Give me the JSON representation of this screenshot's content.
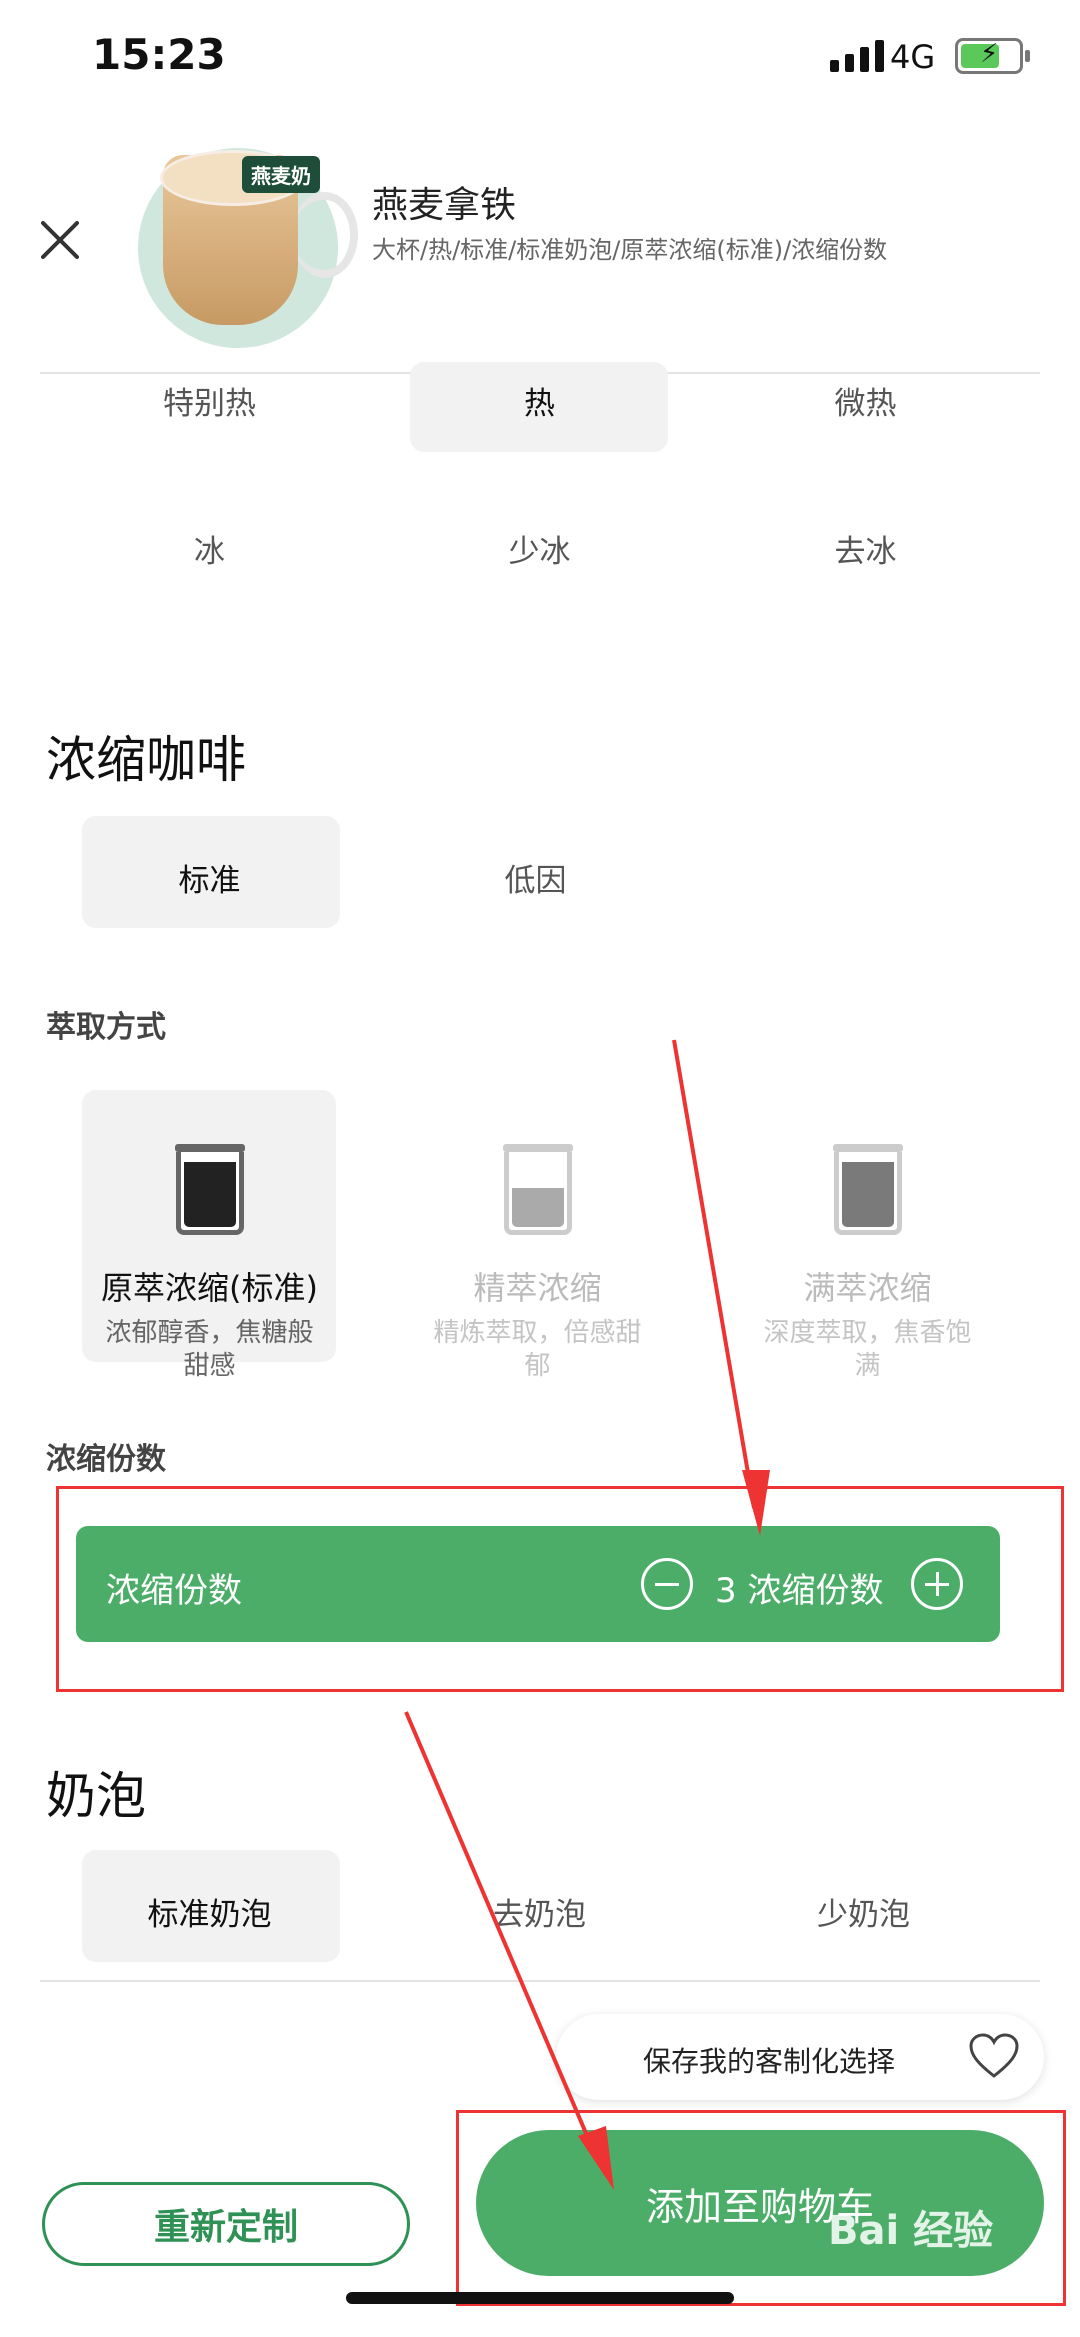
{
  "status_bar": {
    "time": "15:23",
    "network": "4G"
  },
  "product": {
    "tag": "燕麦奶",
    "name": "燕麦拿铁",
    "spec": "大杯/热/标准/标准奶泡/原萃浓缩(标准)/浓缩份数"
  },
  "temperature": {
    "options": [
      "特别热",
      "热",
      "微热",
      "冰",
      "少冰",
      "去冰"
    ],
    "selected": "热"
  },
  "espresso": {
    "title": "浓缩咖啡",
    "options": [
      "标准",
      "低因"
    ],
    "selected": "标准"
  },
  "extraction": {
    "title": "萃取方式",
    "options": [
      {
        "name": "原萃浓缩(标准)",
        "desc": [
          "浓郁醇香，焦糖般",
          "甜感"
        ]
      },
      {
        "name": "精萃浓缩",
        "desc": [
          "精炼萃取，倍感甜",
          "郁"
        ]
      },
      {
        "name": "满萃浓缩",
        "desc": [
          "深度萃取，焦香饱",
          "满"
        ]
      }
    ],
    "selected": "原萃浓缩(标准)"
  },
  "shots": {
    "title": "浓缩份数",
    "bar_label": "浓缩份数",
    "value": "3 浓缩份数"
  },
  "foam": {
    "title": "奶泡",
    "options": [
      "标准奶泡",
      "去奶泡",
      "少奶泡"
    ],
    "selected": "标准奶泡"
  },
  "save": {
    "label": "保存我的客制化选择"
  },
  "actions": {
    "reset": "重新定制",
    "add_to_cart": "添加至购物车"
  },
  "watermark": "Bai 经验",
  "colors": {
    "brand_green": "#4cad69",
    "annotation_red": "#e33333"
  }
}
